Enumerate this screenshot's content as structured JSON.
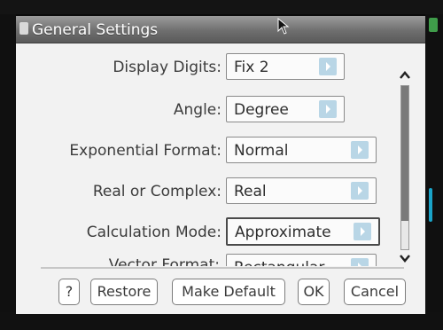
{
  "dialog": {
    "title": "General Settings"
  },
  "settings": [
    {
      "label": "Display Digits:",
      "value": "Fix 2"
    },
    {
      "label": "Angle:",
      "value": "Degree"
    },
    {
      "label": "Exponential Format:",
      "value": "Normal"
    },
    {
      "label": "Real or Complex:",
      "value": "Real"
    },
    {
      "label": "Calculation Mode:",
      "value": "Approximate"
    },
    {
      "label": "Vector Format:",
      "value": "Rectangular"
    }
  ],
  "buttons": {
    "help": "?",
    "restore": "Restore",
    "make_default": "Make Default",
    "ok": "OK",
    "cancel": "Cancel"
  },
  "scroll": {
    "position": 0.82
  },
  "colors": {
    "titlebar": "#6f6f6f",
    "dropdown_arrow": "#b9d6e6",
    "accent": "#1aa4c9"
  }
}
